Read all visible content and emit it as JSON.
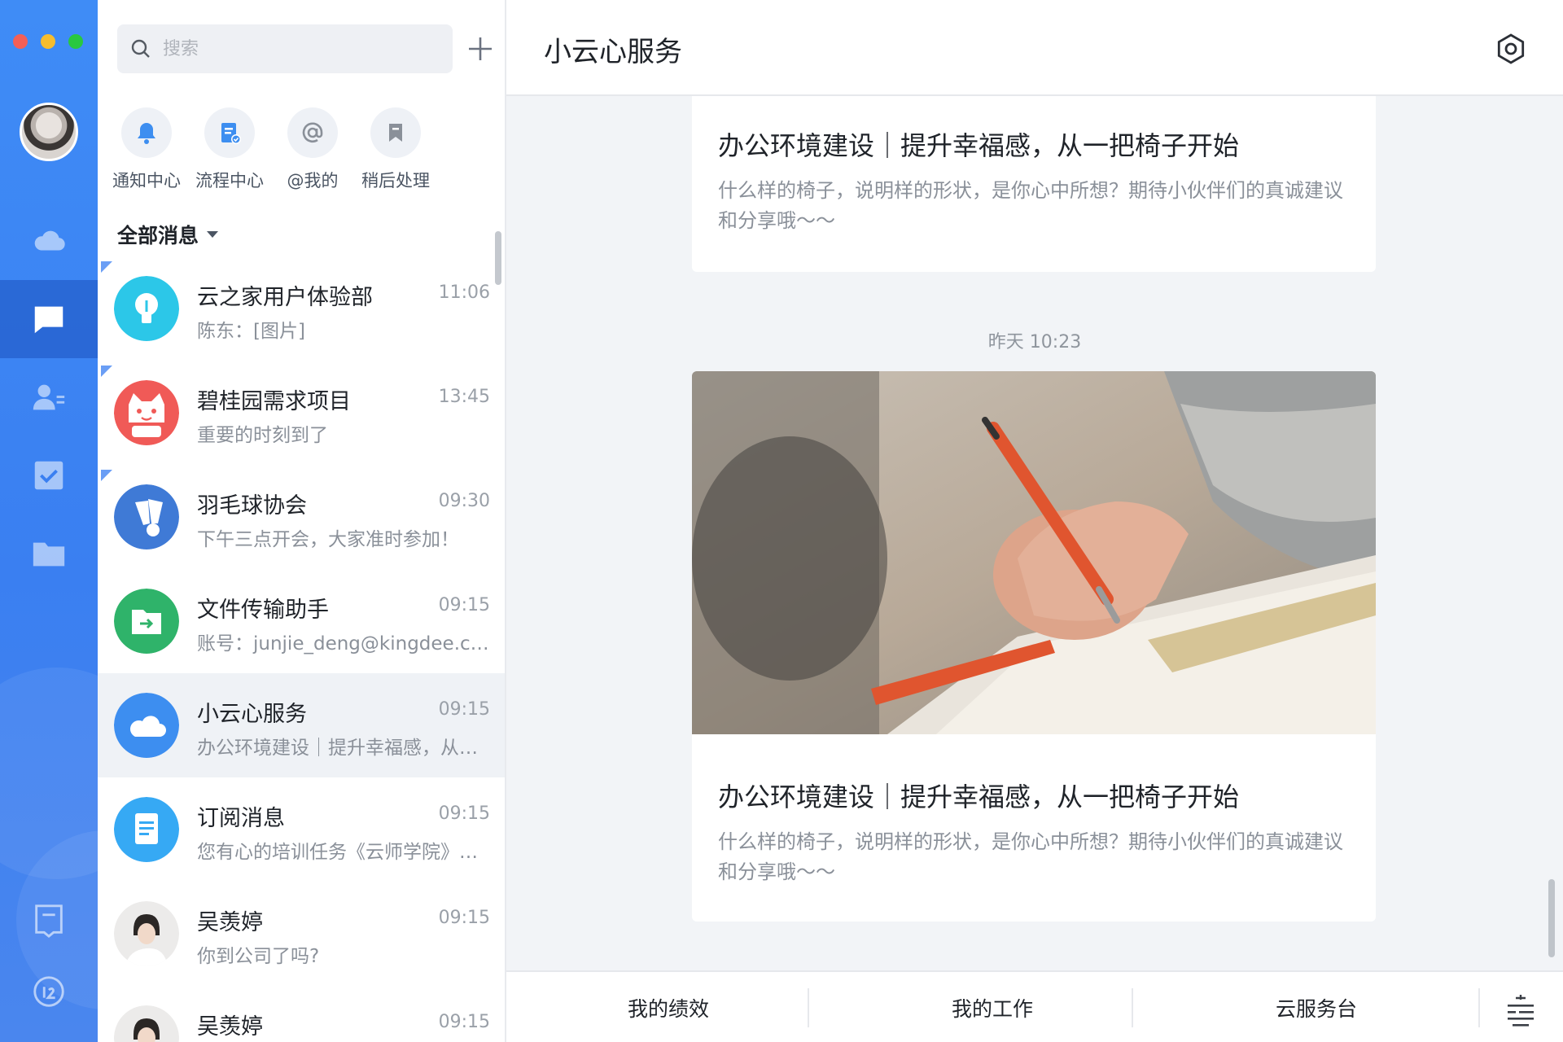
{
  "search": {
    "placeholder": "搜索"
  },
  "quick_actions": [
    {
      "label": "通知中心",
      "icon": "bell-icon"
    },
    {
      "label": "流程中心",
      "icon": "workflow-doc-icon"
    },
    {
      "label": "@我的",
      "icon": "at-icon"
    },
    {
      "label": "稍后处理",
      "icon": "bookmark-icon"
    }
  ],
  "filter": {
    "label": "全部消息"
  },
  "conversations": [
    {
      "name": "云之家用户体验部",
      "time": "11:06",
      "preview": "陈东：[图片]",
      "avatar": "lightbulb-icon",
      "color": "#2cc7e8",
      "pinned": true
    },
    {
      "name": "碧桂园需求项目",
      "time": "13:45",
      "preview": "重要的时刻到了",
      "avatar": "lucky-cat-icon",
      "color": "#f05a57",
      "pinned": true
    },
    {
      "name": "羽毛球协会",
      "time": "09:30",
      "preview": "下午三点开会，大家准时参加！",
      "avatar": "shuttlecock-icon",
      "color": "#3f7ad6",
      "pinned": true
    },
    {
      "name": "文件传输助手",
      "time": "09:15",
      "preview": "账号：junjie_deng@kingdee.com",
      "avatar": "folder-transfer-icon",
      "color": "#2fb36a"
    },
    {
      "name": "小云心服务",
      "time": "09:15",
      "preview": "办公环境建设｜提升幸福感，从一把椅子开始",
      "avatar": "cloud-icon",
      "color": "#3d8ef0",
      "selected": true
    },
    {
      "name": "订阅消息",
      "time": "09:15",
      "preview": "您有心的培训任务《云师学院》已开始",
      "avatar": "document-icon",
      "color": "#36a9f4"
    },
    {
      "name": "吴羡婷",
      "time": "09:15",
      "preview": "你到公司了吗?",
      "avatar": "person-photo"
    },
    {
      "name": "吴羡婷",
      "time": "09:15",
      "preview": "",
      "avatar": "person-photo"
    }
  ],
  "chat": {
    "title": "小云心服务",
    "timestamp": "昨天 10:23",
    "cards": [
      {
        "title": "办公环境建设｜提升幸福感，从一把椅子开始",
        "desc": "什么样的椅子，说明样的形状，是你心中所想？期待小伙伴们的真诚建议和分享哦～～"
      },
      {
        "title": "办公环境建设｜提升幸福感，从一把椅子开始",
        "desc": "什么样的椅子，说明样的形状，是你心中所想？期待小伙伴们的真诚建议和分享哦～～",
        "image": "pen-writing-photo"
      }
    ]
  },
  "bottom_menu": [
    "我的绩效",
    "我的工作",
    "云服务台"
  ],
  "colors": {
    "accent": "#3d8ef0",
    "rail": "#3a7ff1"
  }
}
